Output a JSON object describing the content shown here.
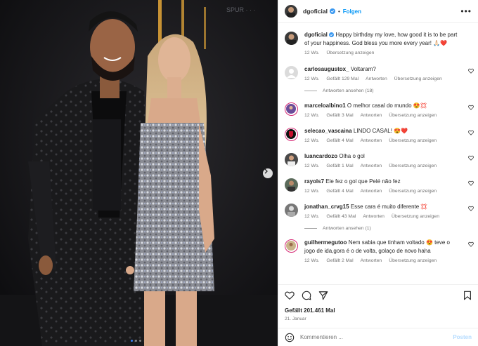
{
  "post": {
    "username": "dgoficial",
    "follow_label": "Folgen",
    "separator": "•",
    "more_label": "•••"
  },
  "caption": {
    "username": "dgoficial",
    "text": "Happy birthday my love, how good it is to be part of your happiness. God bless you more every year! 🙏🏻❤️",
    "time": "12 Wo.",
    "translate": "Übersetzung anzeigen"
  },
  "comments": [
    {
      "username": "carlosaugustox_",
      "text": "Voltaram?",
      "time": "12 Wo.",
      "likes": "Gefällt 129 Mal",
      "reply": "Antworten",
      "translate": "Übersetzung anzeigen"
    },
    {
      "username": "marceloalbino1",
      "text": "O melhor casal do mundo 😍💢",
      "time": "12 Wo.",
      "likes": "Gefällt 3 Mal",
      "reply": "Antworten",
      "translate": "Übersetzung anzeigen"
    },
    {
      "username": "selecao_vascaina",
      "text": "LINDO CASAL! 😍❤️",
      "time": "12 Wo.",
      "likes": "Gefällt 4 Mal",
      "reply": "Antworten",
      "translate": "Übersetzung anzeigen"
    },
    {
      "username": "luancardozo",
      "text": "Olha o gol",
      "time": "12 Wo.",
      "likes": "Gefällt 1 Mal",
      "reply": "Antworten",
      "translate": "Übersetzung anzeigen"
    },
    {
      "username": "rayols7",
      "text": "Ele fez o gol que Pelé não fez",
      "time": "12 Wo.",
      "likes": "Gefällt 4 Mal",
      "reply": "Antworten",
      "translate": "Übersetzung anzeigen"
    },
    {
      "username": "jonathan_crvg15",
      "text": "Esse cara é muito diferente 💢",
      "time": "12 Wo.",
      "likes": "Gefällt 43 Mal",
      "reply": "Antworten",
      "translate": "Übersetzung anzeigen"
    },
    {
      "username": "guilhermegutoo",
      "text": "Nem sabia que tinham voltado 😍 teve o jogo de ida,gora é o de volta, golaço de novo haha",
      "time": "12 Wo.",
      "likes": "Gefällt 2 Mal",
      "reply": "Antworten",
      "translate": "Übersetzung anzeigen"
    }
  ],
  "replies": [
    {
      "label": "Antworten ansehen (18)"
    },
    {
      "label": "Antworten ansehen (1)"
    }
  ],
  "footer": {
    "likes": "Gefällt 201.461 Mal",
    "date": "21. Januar",
    "comment_placeholder": "Kommentieren ...",
    "post_label": "Posten"
  },
  "photo": {
    "sign_text": "SPUR ·  ·  ·"
  },
  "colors": {
    "link": "#0095f6",
    "verified": "#3897f0",
    "heart_red": "#ed4956",
    "story_ring": "#d62976"
  }
}
